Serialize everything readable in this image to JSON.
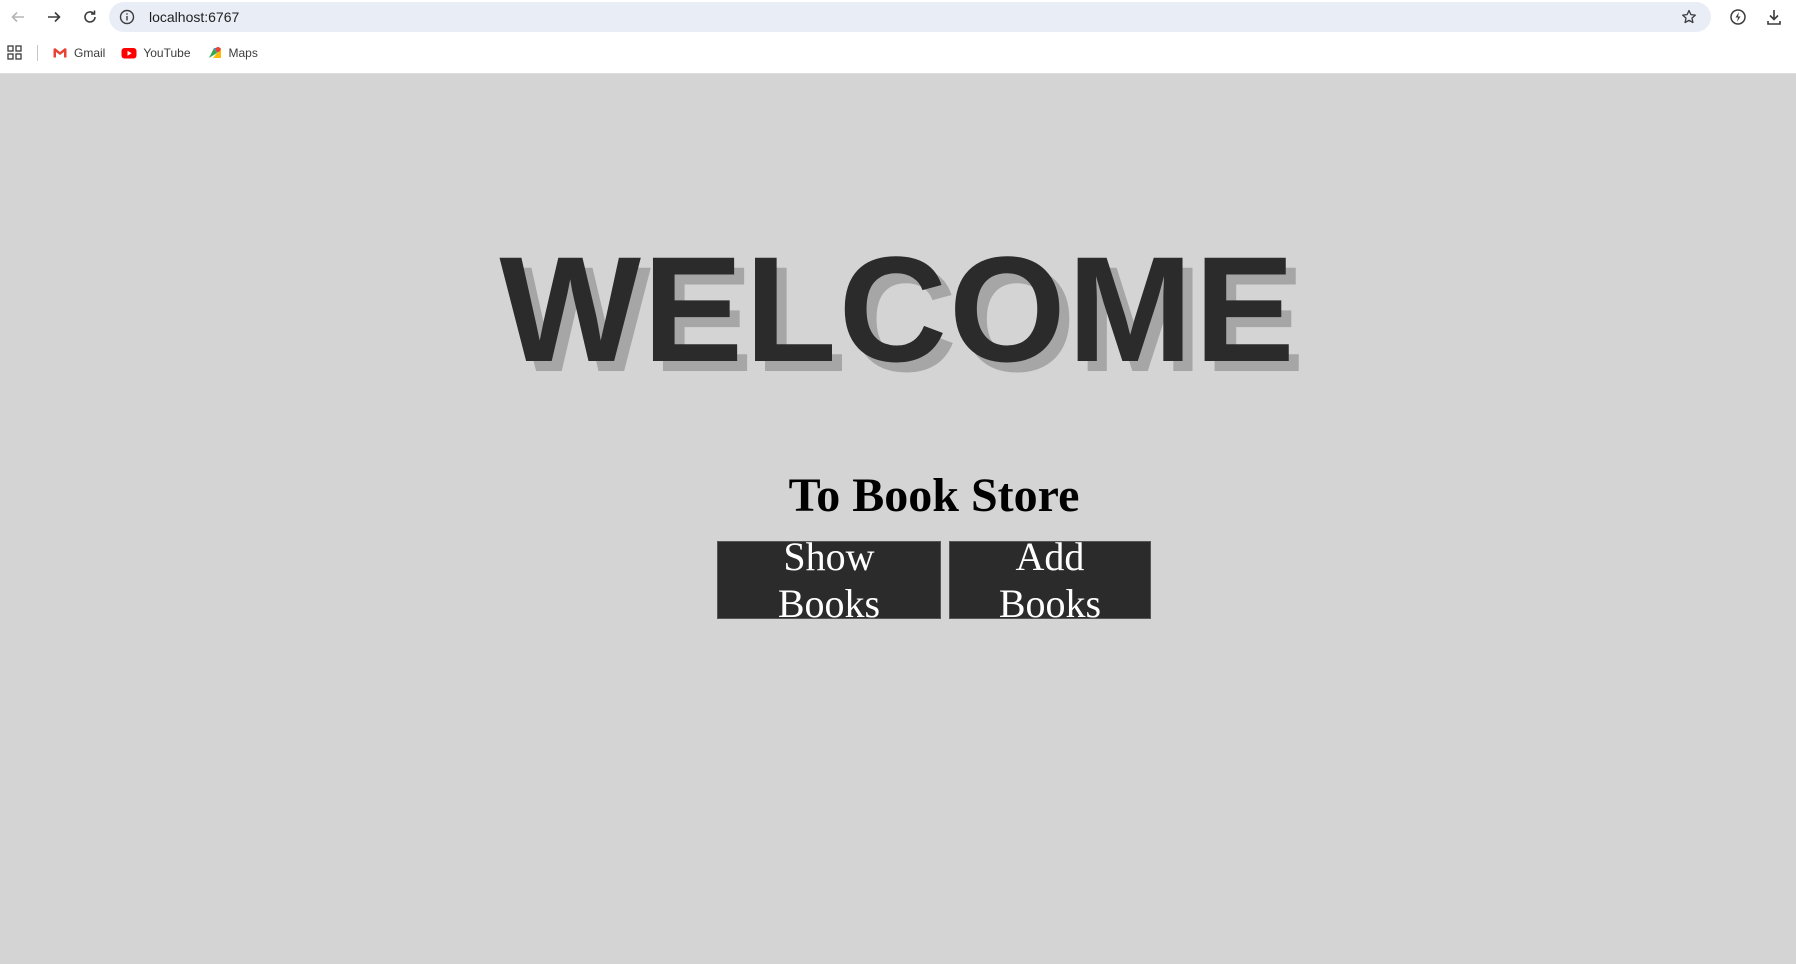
{
  "browser": {
    "url": "localhost:6767",
    "icons": {
      "back": "arrow-left-icon",
      "forward": "arrow-right-icon",
      "reload": "reload-icon",
      "site_info": "info-icon",
      "bookmark": "star-icon",
      "extensions": "extension-icon",
      "downloads": "download-icon"
    }
  },
  "bookmarks": [
    {
      "label": "Gmail",
      "icon": "gmail-icon"
    },
    {
      "label": "YouTube",
      "icon": "youtube-icon"
    },
    {
      "label": "Maps",
      "icon": "maps-icon"
    }
  ],
  "page": {
    "heading": "WELCOME",
    "subtitle": "To Book Store",
    "show_books_label": "Show Books",
    "add_books_label": "Add Books",
    "colors": {
      "background": "#d4d4d4",
      "heading": "#2b2b2b",
      "heading_shadow": "#a6a6a6",
      "button_bg": "#2b2b2b",
      "button_text": "#ffffff"
    }
  }
}
